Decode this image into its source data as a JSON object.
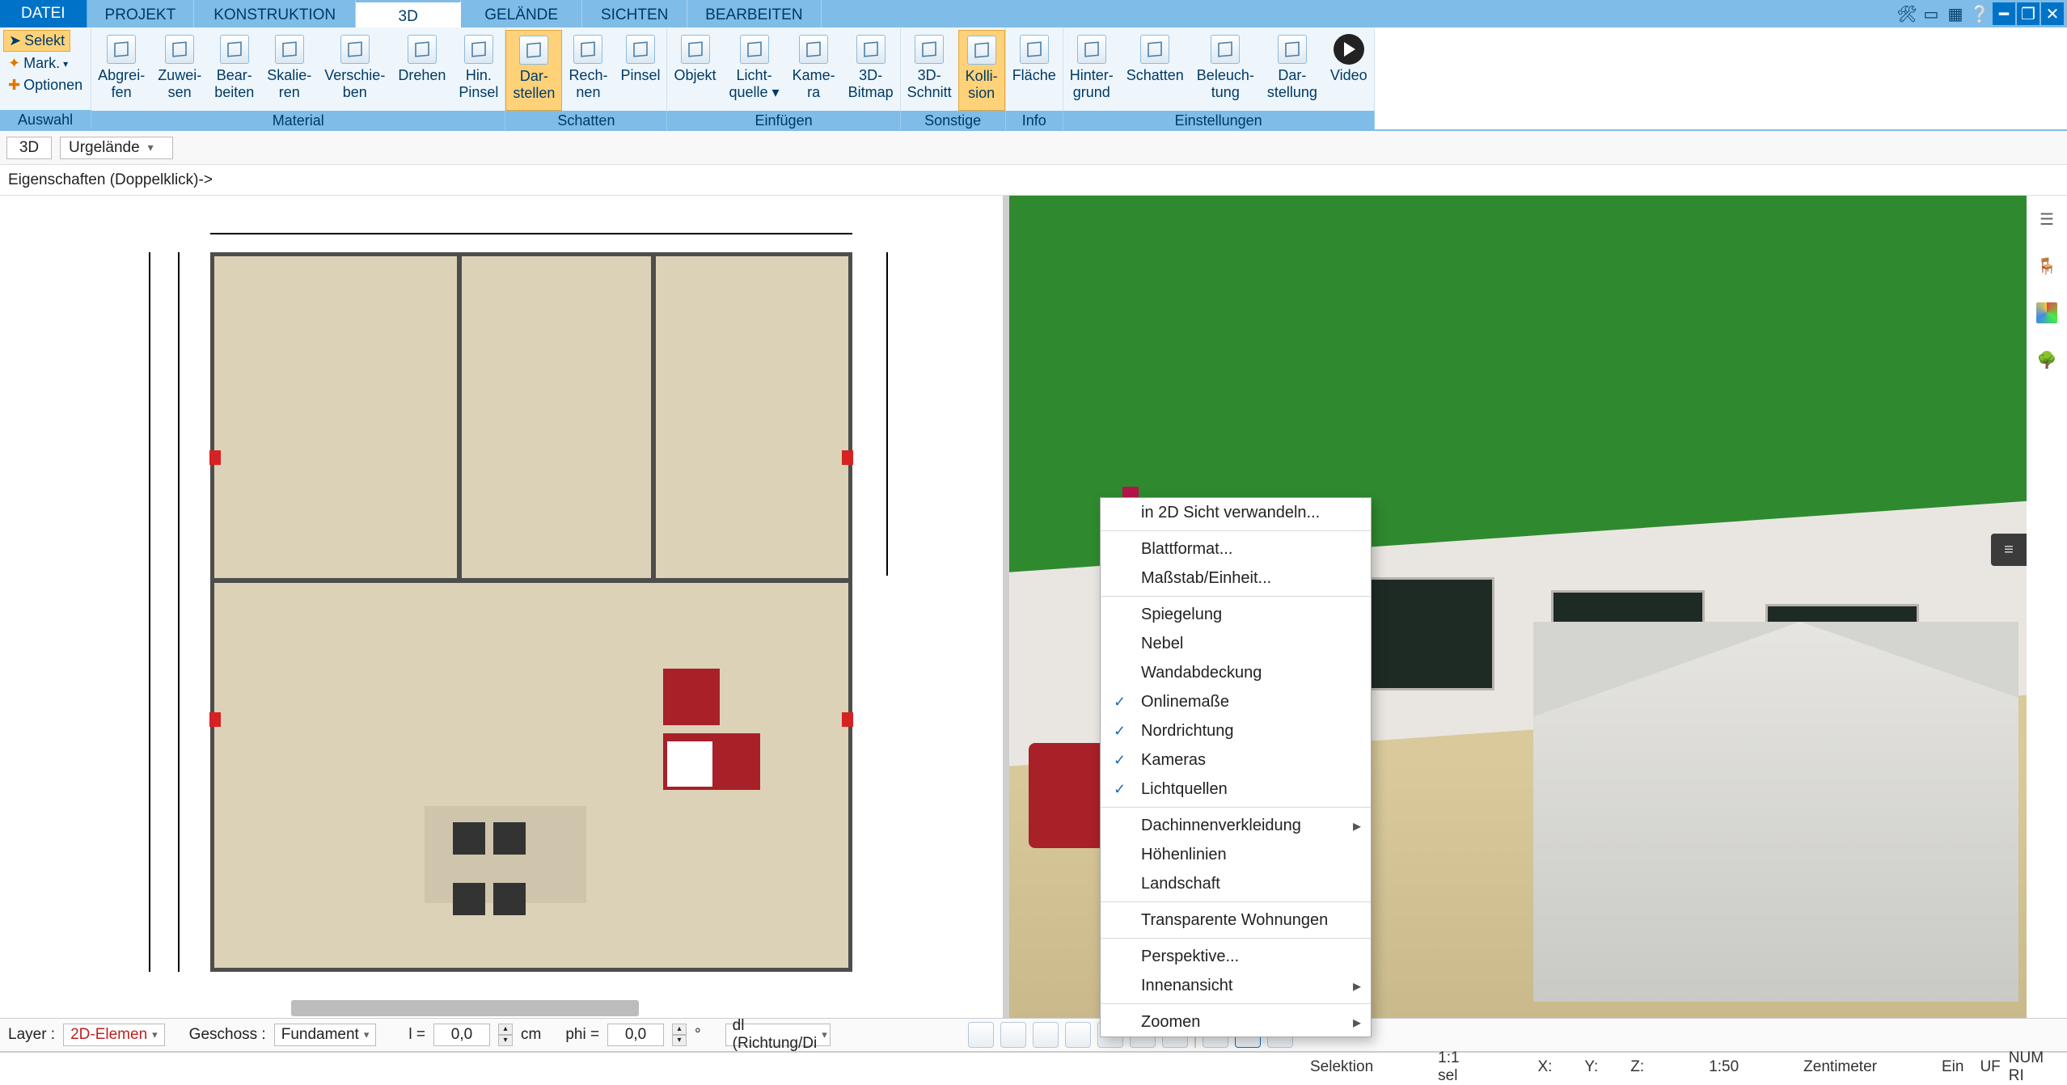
{
  "menu": {
    "file": "DATEI",
    "tabs": [
      "PROJEKT",
      "KONSTRUKTION",
      "3D",
      "GELÄNDE",
      "SICHTEN",
      "BEARBEITEN"
    ],
    "active_index": 2
  },
  "auswahl": {
    "selekt": "Selekt",
    "mark": "Mark.",
    "optionen": "Optionen",
    "group_label": "Auswahl"
  },
  "ribbon_groups": [
    {
      "label": "Material",
      "buttons": [
        {
          "l1": "Abgrei-",
          "l2": "fen"
        },
        {
          "l1": "Zuwei-",
          "l2": "sen"
        },
        {
          "l1": "Bear-",
          "l2": "beiten"
        },
        {
          "l1": "Skalie-",
          "l2": "ren"
        },
        {
          "l1": "Verschie-",
          "l2": "ben"
        },
        {
          "l1": "Drehen",
          "l2": ""
        },
        {
          "l1": "Hin.",
          "l2": "Pinsel"
        }
      ]
    },
    {
      "label": "Schatten",
      "buttons": [
        {
          "l1": "Dar-",
          "l2": "stellen",
          "active": true
        },
        {
          "l1": "Rech-",
          "l2": "nen"
        },
        {
          "l1": "Pinsel",
          "l2": ""
        }
      ]
    },
    {
      "label": "Einfügen",
      "buttons": [
        {
          "l1": "Objekt",
          "l2": ""
        },
        {
          "l1": "Licht-",
          "l2": "quelle",
          "dd": true
        },
        {
          "l1": "Kame-",
          "l2": "ra"
        },
        {
          "l1": "3D-",
          "l2": "Bitmap"
        }
      ]
    },
    {
      "label": "Sonstige",
      "buttons": [
        {
          "l1": "3D-",
          "l2": "Schnitt"
        },
        {
          "l1": "Kolli-",
          "l2": "sion",
          "active": true
        }
      ]
    },
    {
      "label": "Info",
      "buttons": [
        {
          "l1": "Fläche",
          "l2": ""
        }
      ]
    },
    {
      "label": "Einstellungen",
      "buttons": [
        {
          "l1": "Hinter-",
          "l2": "grund"
        },
        {
          "l1": "Schatten",
          "l2": ""
        },
        {
          "l1": "Beleuch-",
          "l2": "tung"
        },
        {
          "l1": "Dar-",
          "l2": "stellung"
        },
        {
          "l1": "Video",
          "l2": "",
          "play": true
        }
      ]
    }
  ],
  "secbar": {
    "mode": "3D",
    "layer": "Urgelände"
  },
  "propbar": {
    "text": "Eigenschaften (Doppelklick)->"
  },
  "context_menu": {
    "items": [
      {
        "label": "in 2D Sicht verwandeln..."
      },
      {
        "sep": true
      },
      {
        "label": "Blattformat..."
      },
      {
        "label": "Maßstab/Einheit..."
      },
      {
        "sep": true
      },
      {
        "label": "Spiegelung"
      },
      {
        "label": "Nebel"
      },
      {
        "label": "Wandabdeckung"
      },
      {
        "label": "Onlinemaße",
        "checked": true
      },
      {
        "label": "Nordrichtung",
        "checked": true
      },
      {
        "label": "Kameras",
        "checked": true
      },
      {
        "label": "Lichtquellen",
        "checked": true
      },
      {
        "sep": true
      },
      {
        "label": "Dachinnenverkleidung",
        "sub": true
      },
      {
        "label": "Höhenlinien"
      },
      {
        "label": "Landschaft"
      },
      {
        "sep": true
      },
      {
        "label": "Transparente Wohnungen"
      },
      {
        "sep": true
      },
      {
        "label": "Perspektive..."
      },
      {
        "label": "Innenansicht",
        "sub": true
      },
      {
        "sep": true
      },
      {
        "label": "Zoomen",
        "sub": true
      }
    ]
  },
  "bottom": {
    "layer_label": "Layer :",
    "layer_value": "2D-Elemen",
    "geschoss_label": "Geschoss :",
    "geschoss_value": "Fundament",
    "l_label": "l =",
    "l_value": "0,0",
    "l_unit": "cm",
    "phi_label": "phi =",
    "phi_value": "0,0",
    "phi_unit": "°",
    "dl_label": "dl (Richtung/Di"
  },
  "status": {
    "selektion": "Selektion",
    "sel_ratio": "1:1 sel",
    "x": "X:",
    "y": "Y:",
    "z": "Z:",
    "scale": "1:50",
    "unit": "Zentimeter",
    "ein": "Ein",
    "uf": "UF",
    "num": "NUM RI"
  }
}
